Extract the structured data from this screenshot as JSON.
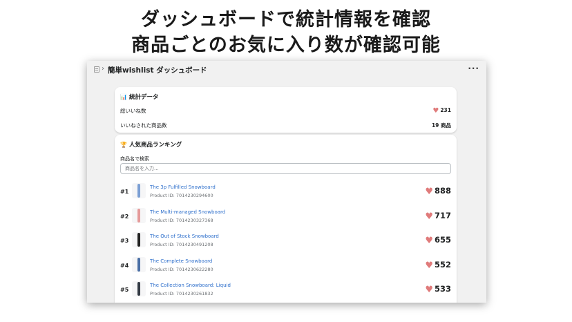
{
  "headline": {
    "line1": "ダッシュボードで統計情報を確認",
    "line2": "商品ごとのお気に入り数が確認可能"
  },
  "window": {
    "title": "簡単wishlist ダッシュボード",
    "breadcrumb_separator": "›",
    "more_glyph": "···"
  },
  "stats": {
    "title": "統計データ",
    "icon": "bar-chart-icon",
    "total_likes_label": "総いいね数",
    "total_likes_value": "231",
    "liked_products_label": "いいねされた商品数",
    "liked_products_value": "19 商品"
  },
  "ranking": {
    "title": "人気商品ランキング",
    "icon": "trophy-icon",
    "search_label": "商品名で検索",
    "search_placeholder": "商品名を入力...",
    "search_value": "",
    "items": [
      {
        "rank": "#1",
        "name": "The 3p Fulfilled Snowboard",
        "product_id": "Product ID: 7014230294600",
        "likes": "888",
        "board_color": "#7b9fd4"
      },
      {
        "rank": "#2",
        "name": "The Multi-managed Snowboard",
        "product_id": "Product ID: 7014230327368",
        "likes": "717",
        "board_color": "#e59a9a"
      },
      {
        "rank": "#3",
        "name": "The Out of Stock Snowboard",
        "product_id": "Product ID: 7014230491208",
        "likes": "655",
        "board_color": "#222222"
      },
      {
        "rank": "#4",
        "name": "The Complete Snowboard",
        "product_id": "Product ID: 7014230622280",
        "likes": "552",
        "board_color": "#4a6fa5"
      },
      {
        "rank": "#5",
        "name": "The Collection Snowboard: Liquid",
        "product_id": "Product ID: 7014230261832",
        "likes": "533",
        "board_color": "#333a44"
      }
    ]
  },
  "colors": {
    "heart": "#e07b7b",
    "link": "#2c6ecb",
    "window_bg": "#f1f1f1"
  }
}
